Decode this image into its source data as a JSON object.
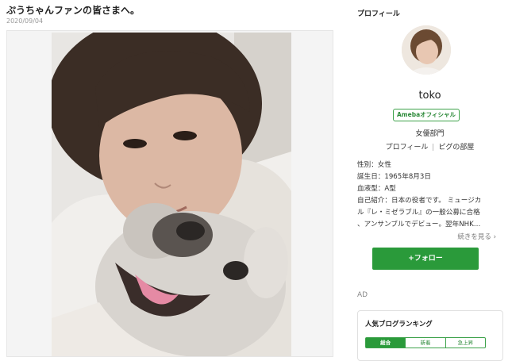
{
  "post": {
    "title": "ぷうちゃんファンの皆さまへ。",
    "date": "2020/09/04"
  },
  "sidebar": {
    "heading": "プロフィール",
    "username": "toko",
    "badge": "Amebaオフィシャル",
    "category": "女優部門",
    "links": [
      "プロフィール",
      "ピグの部屋"
    ],
    "info": [
      "性別：女性",
      "誕生日：1965年8月3日",
      "血液型：A型",
      "自己紹介：日本の役者です。 ミュージカ",
      "ル『レ・ミゼラブル』の一般公募に合格",
      "、アンサンブルでデビュー。翌年NHK…"
    ],
    "read_more": "続きを見る ›",
    "follow": "+フォロー"
  },
  "ad": {
    "label": "AD"
  },
  "ranking": {
    "title": "人気ブログランキング",
    "tabs": [
      "総合",
      "新着",
      "急上昇"
    ]
  },
  "colors": {
    "accent": "#2a9a3a",
    "badge": "#3da24a"
  }
}
